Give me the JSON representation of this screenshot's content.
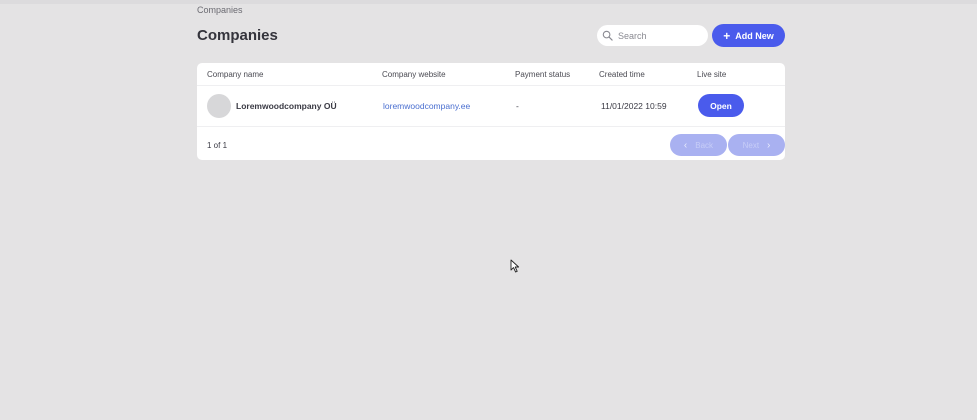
{
  "breadcrumb": "Companies",
  "page_title": "Companies",
  "search": {
    "placeholder": "Search"
  },
  "add_button": {
    "icon": "plus-icon",
    "label": "Add New"
  },
  "table": {
    "columns": [
      "Company name",
      "Company website",
      "Payment status",
      "Created time",
      "Live site"
    ],
    "rows": [
      {
        "name": "Loremwoodcompany OÜ",
        "website": "loremwoodcompany.ee",
        "payment_status": "-",
        "created_time": "11/01/2022 10:59",
        "live_site_button": "Open"
      }
    ]
  },
  "pagination": {
    "text": "1 of 1",
    "back_label": "Back",
    "next_label": "Next"
  },
  "colors": {
    "background": "#e4e3e4",
    "accent": "#4a5bec",
    "link": "#4a6fd0",
    "disabled_button": "#a9b1f1"
  }
}
